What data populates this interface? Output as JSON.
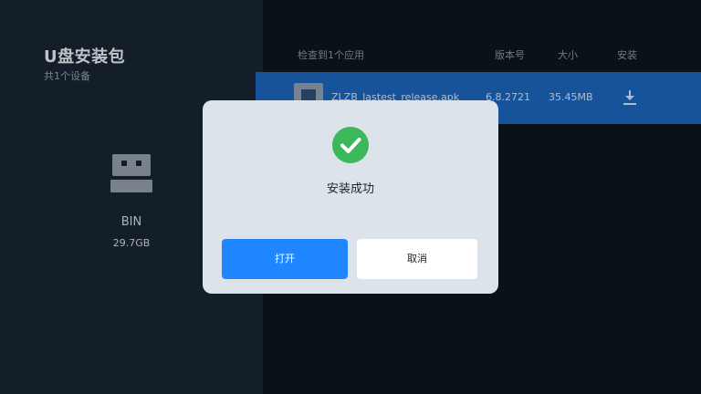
{
  "left_panel": {
    "title": "U盘安装包",
    "subtitle": "共1个设备",
    "device": {
      "icon": "usb-drive-icon",
      "name": "BIN",
      "size": "29.7GB"
    }
  },
  "list": {
    "header": {
      "found": "检查到1个应用",
      "version": "版本号",
      "size": "大小",
      "install": "安装"
    },
    "rows": [
      {
        "icon": "apk-file-icon",
        "filename": "ZLZB_lastest_release.apk",
        "version": "6.8.2721",
        "size": "35.45MB",
        "install_icon": "download-icon"
      }
    ]
  },
  "dialog": {
    "icon": "success-check-icon",
    "message": "安装成功",
    "open_label": "打开",
    "cancel_label": "取消"
  },
  "colors": {
    "accent": "#1f86ff",
    "selected_row": "#1a5fb0",
    "success": "#3cb85a",
    "dialog_bg": "#dde3ea"
  }
}
